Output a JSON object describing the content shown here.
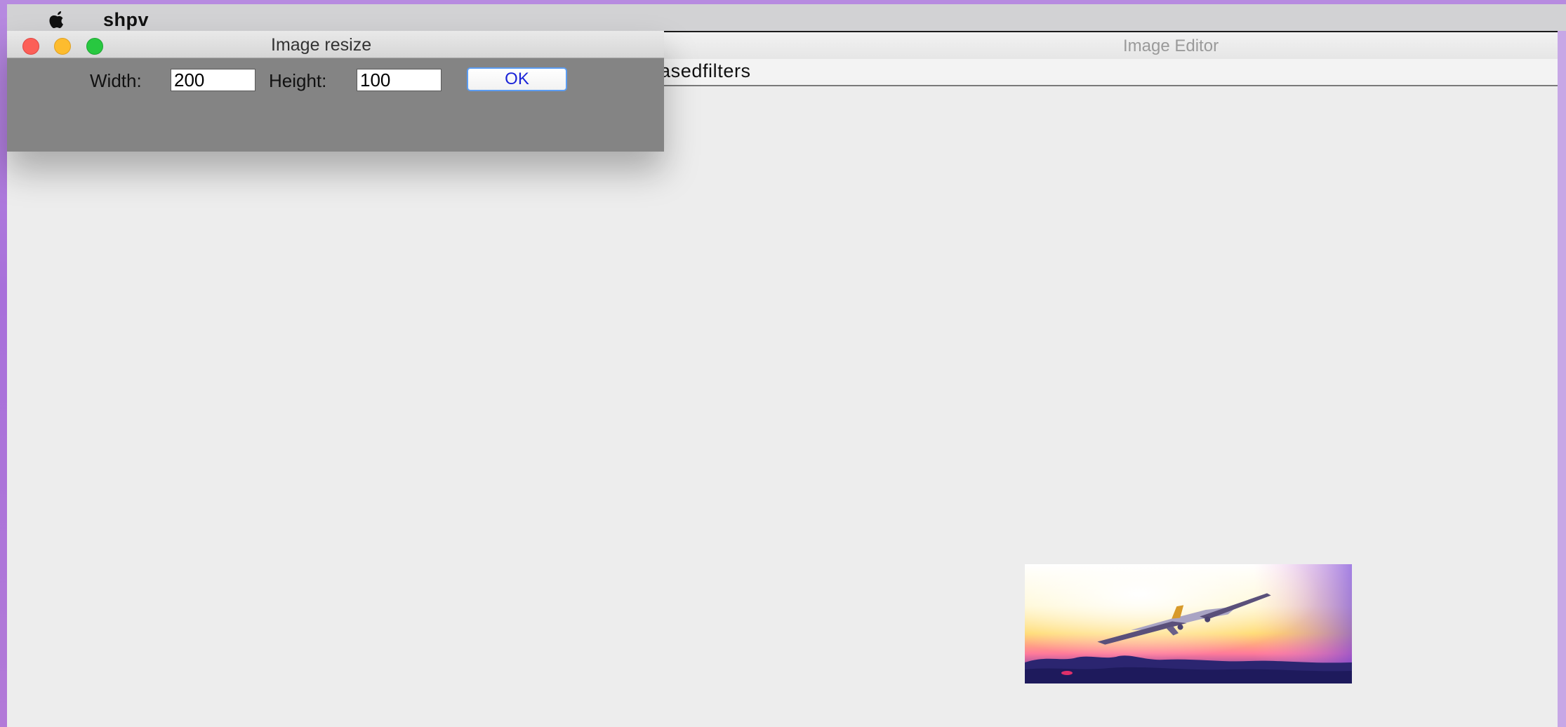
{
  "menubar": {
    "app_name": "shpv",
    "apple_icon": "apple-logo-icon"
  },
  "main_window": {
    "title": "Image Editor",
    "toolbar_text": "asedfilters"
  },
  "dialog": {
    "title": "Image resize",
    "width_label": "Width:",
    "width_value": "200",
    "height_label": "Height:",
    "height_value": "100",
    "ok_label": "OK",
    "controls": [
      "close",
      "minimize",
      "zoom"
    ]
  },
  "preview": {
    "description_icon": "airplane-sunset-image"
  },
  "colors": {
    "desktop": "#b78be0",
    "window_background": "#ededed",
    "dialog_background": "#848484",
    "ok_border": "#5b9cf1",
    "ok_text": "#1b24d8",
    "close": "#fc5f57",
    "minimize": "#fdbc2e",
    "zoom": "#28c840"
  }
}
